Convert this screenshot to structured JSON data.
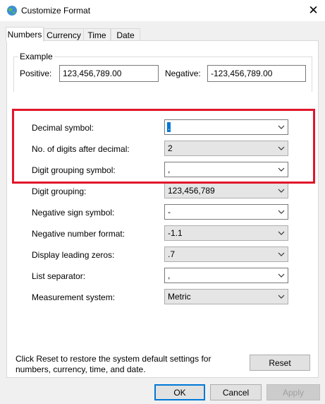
{
  "window": {
    "title": "Customize Format",
    "close_glyph": "✕"
  },
  "tabs": [
    {
      "label": "Numbers",
      "active": true
    },
    {
      "label": "Currency"
    },
    {
      "label": "Time"
    },
    {
      "label": "Date"
    }
  ],
  "example": {
    "label": "Example",
    "positive_label": "Positive:",
    "positive_value": "123,456,789.00",
    "negative_label": "Negative:",
    "negative_value": "-123,456,789.00"
  },
  "settings": [
    {
      "label": "Decimal symbol:",
      "value": "."
    },
    {
      "label": "No. of digits after decimal:",
      "value": "2"
    },
    {
      "label": "Digit grouping symbol:",
      "value": ","
    },
    {
      "label": "Digit grouping:",
      "value": "123,456,789"
    },
    {
      "label": "Negative sign symbol:",
      "value": "-"
    },
    {
      "label": "Negative number format:",
      "value": "-1.1"
    },
    {
      "label": "Display leading zeros:",
      "value": ".7"
    },
    {
      "label": "List separator:",
      "value": ","
    },
    {
      "label": "Measurement system:",
      "value": "Metric"
    }
  ],
  "reset_note": "Click Reset to restore the system default settings for numbers, currency, time, and date.",
  "buttons": {
    "reset": "Reset",
    "ok": "OK",
    "cancel": "Cancel",
    "apply": "Apply"
  },
  "colors": {
    "highlight": "#e0162b",
    "focus_accent": "#0078d7"
  }
}
